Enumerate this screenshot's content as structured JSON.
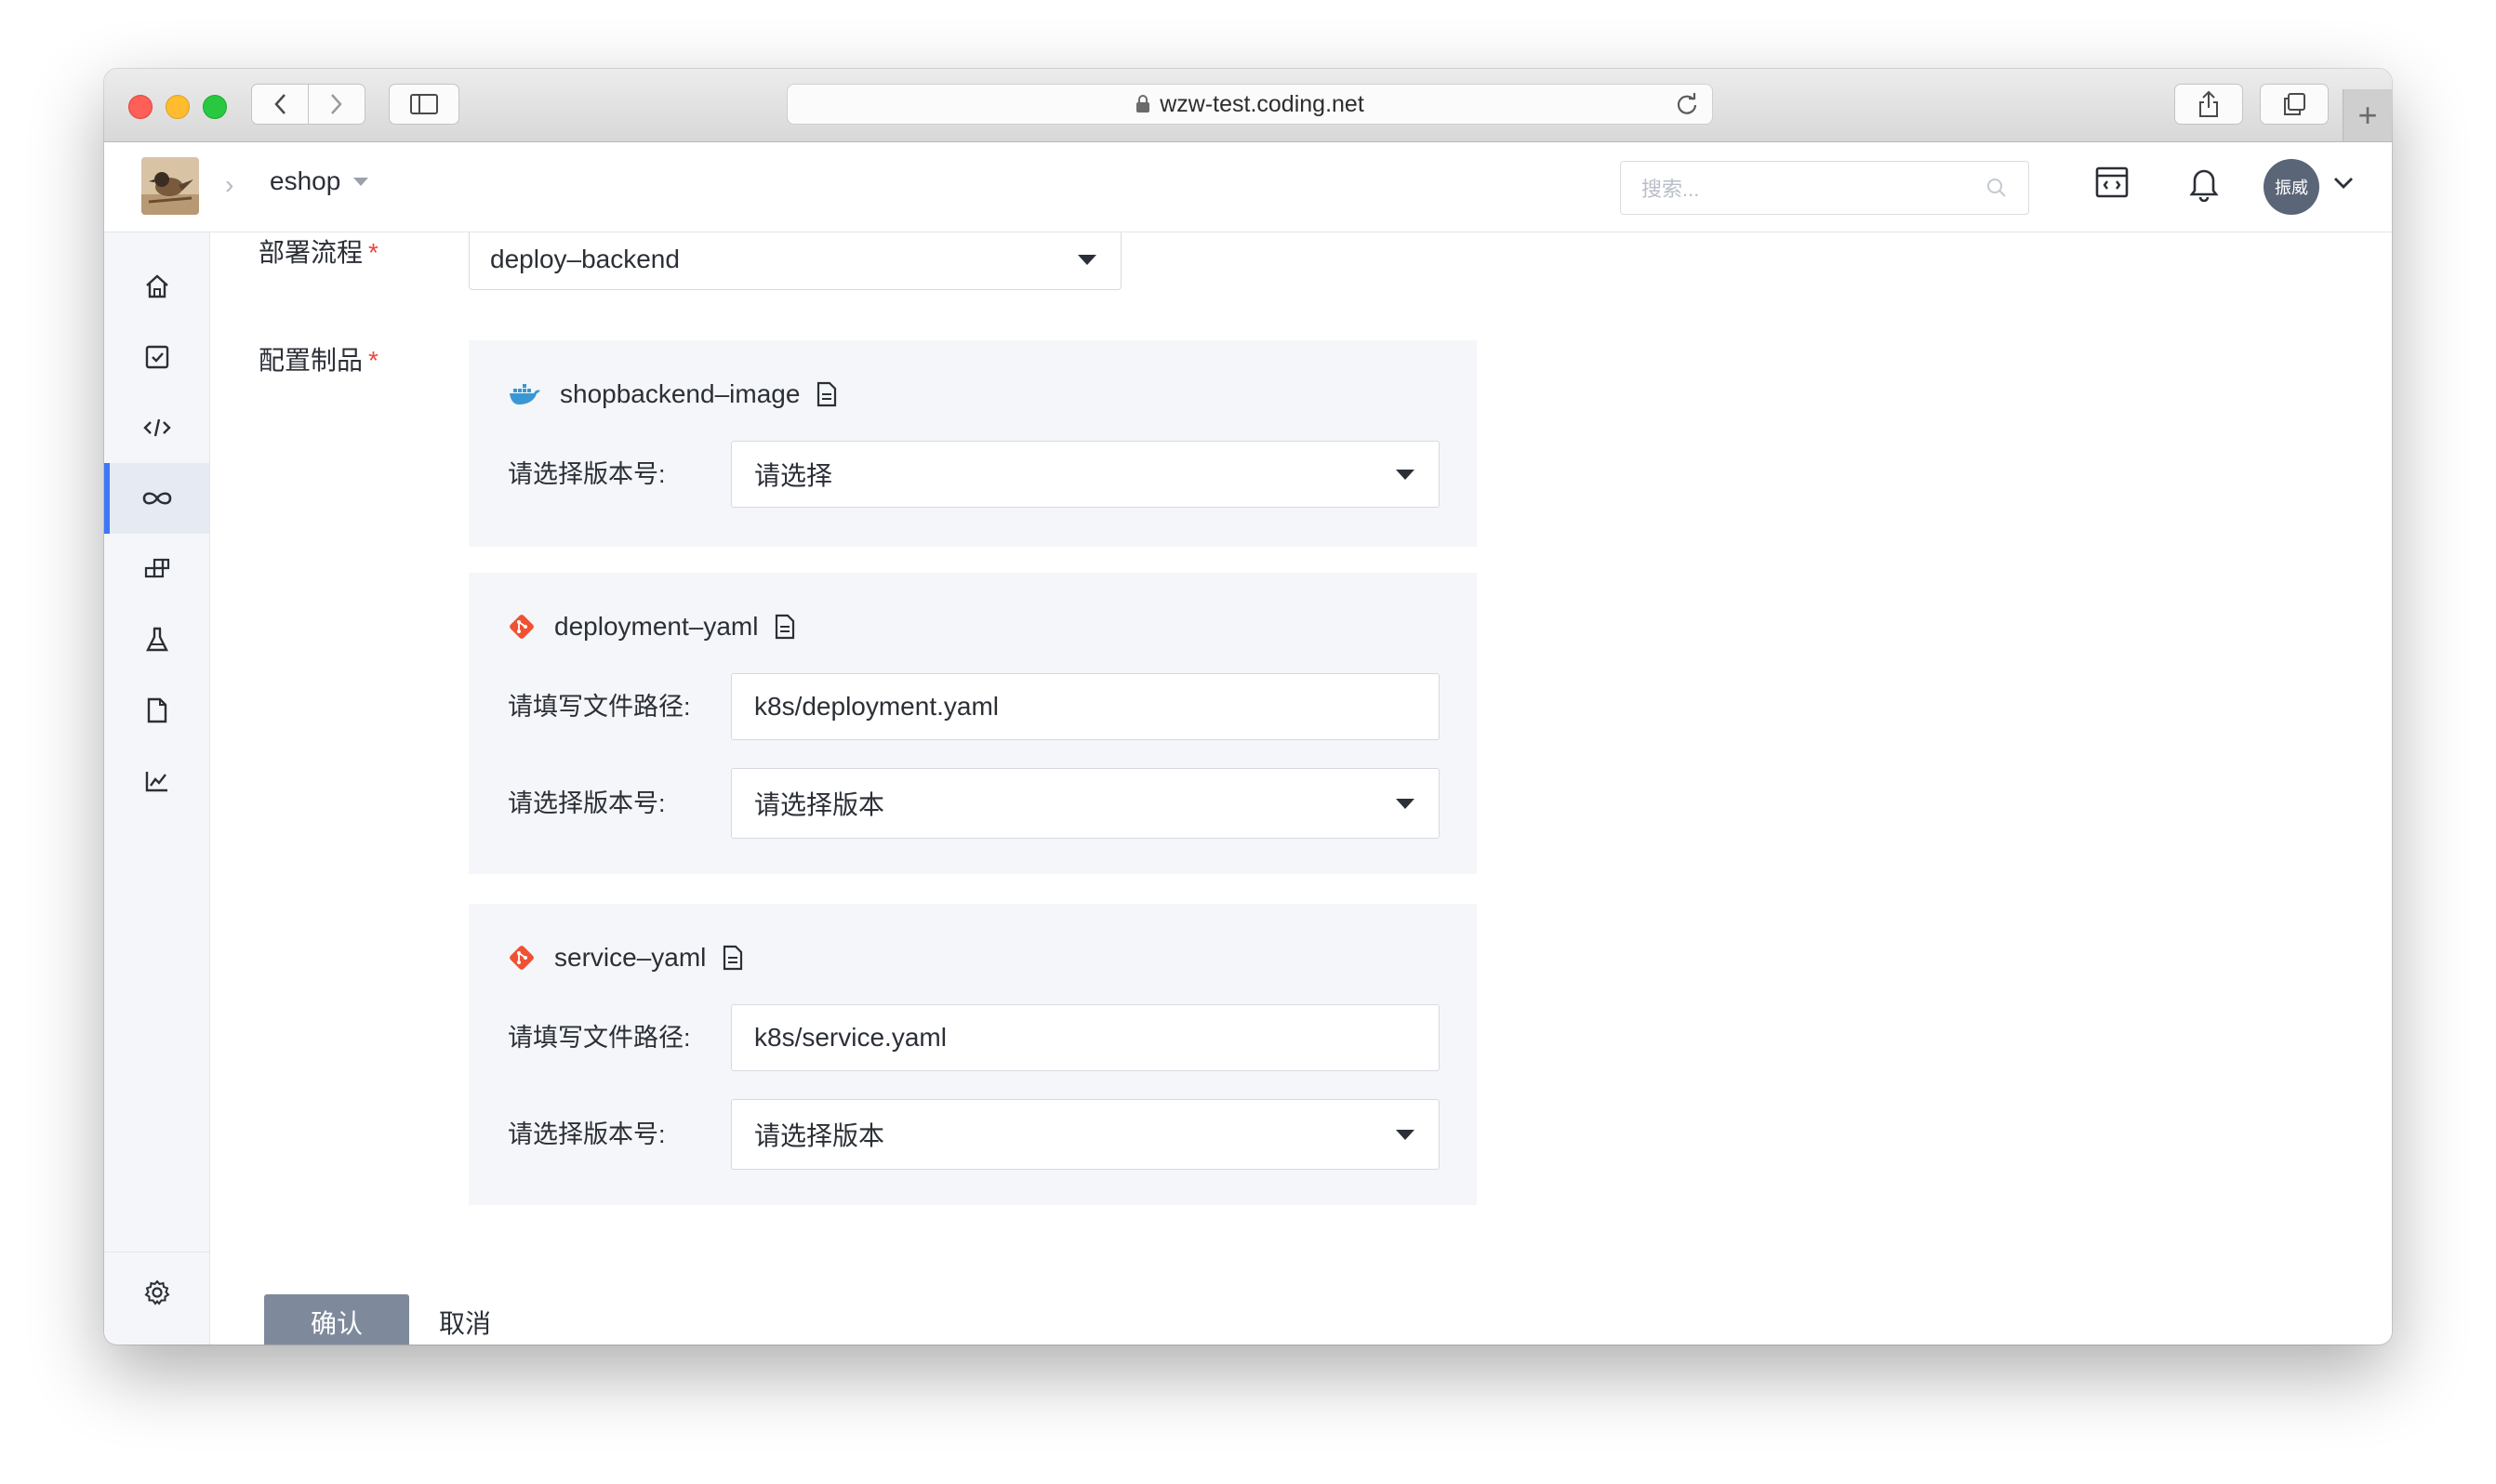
{
  "browser": {
    "url": "wzw-test.coding.net",
    "new_tab_symbol": "+"
  },
  "header": {
    "project_name": "eshop",
    "search_placeholder": "搜索...",
    "user_name": "振威"
  },
  "sidebar": {
    "items": [
      {
        "name": "home-icon"
      },
      {
        "name": "tasks-icon"
      },
      {
        "name": "code-icon"
      },
      {
        "name": "continuous-deploy-icon",
        "active": true
      },
      {
        "name": "artifacts-icon"
      },
      {
        "name": "testing-icon"
      },
      {
        "name": "docs-icon"
      },
      {
        "name": "stats-icon"
      }
    ],
    "bottom": [
      {
        "name": "settings-icon"
      },
      {
        "name": "expand-icon"
      }
    ]
  },
  "form": {
    "pipeline_label": "部署流程",
    "pipeline_value": "deploy–backend",
    "artifacts_label": "配置制品",
    "required_mark": "*",
    "artifacts": [
      {
        "name": "shopbackend–image",
        "type_icon": "docker-icon",
        "version_label": "请选择版本号:",
        "version_value": "请选择"
      },
      {
        "name": "deployment–yaml",
        "type_icon": "git-icon",
        "path_label": "请填写文件路径:",
        "path_value": "k8s/deployment.yaml",
        "version_label": "请选择版本号:",
        "version_value": "请选择版本"
      },
      {
        "name": "service–yaml",
        "type_icon": "git-icon",
        "path_label": "请填写文件路径:",
        "path_value": "k8s/service.yaml",
        "version_label": "请选择版本号:",
        "version_value": "请选择版本"
      }
    ],
    "confirm_label": "确认",
    "cancel_label": "取消"
  },
  "colors": {
    "primary_button": "#7e8a9c",
    "active_accent": "#3e76f6",
    "required": "#f0443e",
    "git": "#f05133",
    "docker": "#3a97d4"
  }
}
